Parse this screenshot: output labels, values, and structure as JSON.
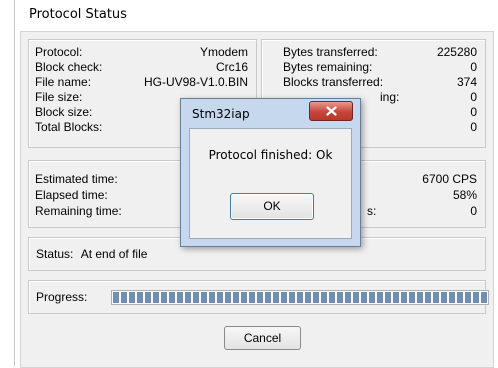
{
  "window": {
    "title": "Protocol Status"
  },
  "info_left": [
    {
      "label": "Protocol:",
      "value": "Ymodem"
    },
    {
      "label": "Block check:",
      "value": "Crc16"
    },
    {
      "label": "File name:",
      "value": "HG-UV98-V1.0.BIN"
    },
    {
      "label": "File size:",
      "value": ""
    },
    {
      "label": "Block size:",
      "value": ""
    },
    {
      "label": "Total Blocks:",
      "value": ""
    }
  ],
  "info_right": [
    {
      "label": "Bytes transferred:",
      "value": "225280"
    },
    {
      "label": "Bytes remaining:",
      "value": "0"
    },
    {
      "label": "Blocks transferred:",
      "value": "374"
    },
    {
      "label": "",
      "value": "0"
    },
    {
      "label": "",
      "value": "0"
    },
    {
      "label": "",
      "value": "0"
    }
  ],
  "partial_texts": {
    "blocks_remaining_tail": "ing:",
    "errors_tail": "s:"
  },
  "timing_left": [
    {
      "label": "Estimated time:",
      "value": ""
    },
    {
      "label": "Elapsed time:",
      "value": ""
    },
    {
      "label": "Remaining time:",
      "value": ""
    }
  ],
  "timing_right": [
    {
      "label": "",
      "value": "6700 CPS"
    },
    {
      "label": "",
      "value": "58%"
    },
    {
      "label": "",
      "value": "0"
    }
  ],
  "status": {
    "label": "Status:",
    "value": "At end of file"
  },
  "progress": {
    "label": "Progress:",
    "fraction": 1.0
  },
  "cancel_label": "Cancel",
  "dialog": {
    "title": "Stm32iap",
    "message": "Protocol finished: Ok",
    "ok_label": "OK",
    "close_icon": "close-icon"
  },
  "colors": {
    "progress_fill": "#6f8fb8",
    "dialog_frame": "#c6d8ee",
    "close_button": "#c6463a"
  }
}
